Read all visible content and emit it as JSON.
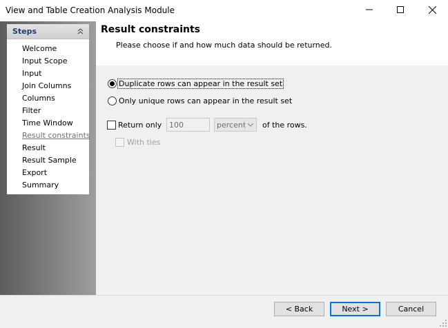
{
  "window": {
    "title": "View and Table Creation Analysis Module",
    "controls": [
      "minimize-icon",
      "maximize-icon",
      "close-icon"
    ]
  },
  "steps": {
    "title": "Steps",
    "items": [
      {
        "label": "Welcome",
        "current": false
      },
      {
        "label": "Input Scope",
        "current": false
      },
      {
        "label": "Input",
        "current": false
      },
      {
        "label": "Join Columns",
        "current": false
      },
      {
        "label": "Columns",
        "current": false
      },
      {
        "label": "Filter",
        "current": false
      },
      {
        "label": "Time Window",
        "current": false
      },
      {
        "label": "Result constraints",
        "current": true
      },
      {
        "label": "Result",
        "current": false
      },
      {
        "label": "Result Sample",
        "current": false
      },
      {
        "label": "Export",
        "current": false
      },
      {
        "label": "Summary",
        "current": false
      }
    ]
  },
  "page": {
    "title": "Result constraints",
    "description": "Please choose if and how much data should be returned."
  },
  "options": {
    "duplicate_rows": {
      "label": "Duplicate rows can appear in the result set",
      "selected": true
    },
    "unique_rows": {
      "label": "Only unique rows can appear in the result set",
      "selected": false
    },
    "return_only": {
      "label": "Return only",
      "checked": false,
      "value": "100",
      "unit": "percent",
      "suffix": "of the rows."
    },
    "with_ties": {
      "label": "With ties",
      "checked": false,
      "enabled": false
    }
  },
  "footer": {
    "back_label": "< Back",
    "next_label": "Next >",
    "cancel_label": "Cancel"
  },
  "colors": {
    "steps_title": "#1e3d6b",
    "default_button_border": "#0078d7",
    "content_bg": "#f0f0f0"
  }
}
